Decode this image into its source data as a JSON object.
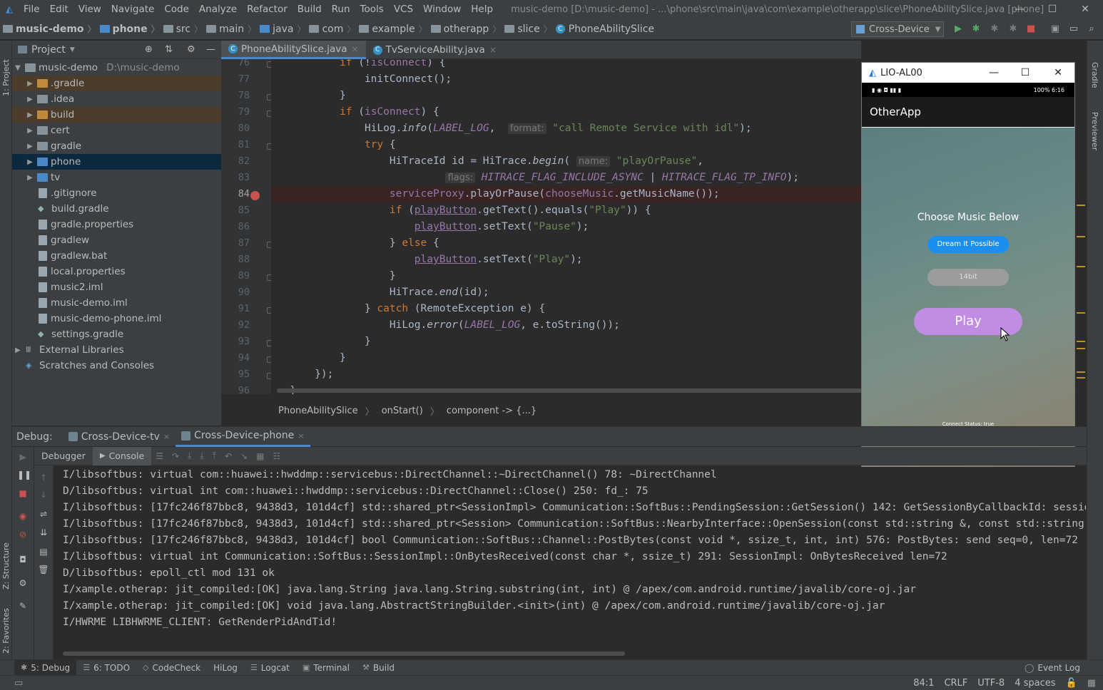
{
  "window": {
    "title": "music-demo [D:\\music-demo] - ...\\phone\\src\\main\\java\\com\\example\\otherapp\\slice\\PhoneAbilitySlice.java [phone]"
  },
  "menu": [
    "File",
    "Edit",
    "View",
    "Navigate",
    "Code",
    "Analyze",
    "Refactor",
    "Build",
    "Run",
    "Tools",
    "VCS",
    "Window",
    "Help"
  ],
  "breadcrumb": [
    "music-demo",
    "phone",
    "src",
    "main",
    "java",
    "com",
    "example",
    "otherapp",
    "slice",
    "PhoneAbilitySlice"
  ],
  "run_config": "Cross-Device",
  "left_strip": {
    "project_tab": "1: Project",
    "structure_tab": "Z: Structure",
    "favorites_tab": "2: Favorites"
  },
  "right_strip": {
    "gradle_tab": "Gradle",
    "previewer_tab": "Previewer"
  },
  "project": {
    "header": "Project",
    "tree": [
      {
        "label": "music-demo",
        "path": "D:\\music-demo"
      },
      {
        "label": ".gradle"
      },
      {
        "label": ".idea"
      },
      {
        "label": "build"
      },
      {
        "label": "cert"
      },
      {
        "label": "gradle"
      },
      {
        "label": "phone"
      },
      {
        "label": "tv"
      },
      {
        "label": ".gitignore"
      },
      {
        "label": "build.gradle"
      },
      {
        "label": "gradle.properties"
      },
      {
        "label": "gradlew"
      },
      {
        "label": "gradlew.bat"
      },
      {
        "label": "local.properties"
      },
      {
        "label": "music2.iml"
      },
      {
        "label": "music-demo.iml"
      },
      {
        "label": "music-demo-phone.iml"
      },
      {
        "label": "settings.gradle"
      },
      {
        "label": "External Libraries"
      },
      {
        "label": "Scratches and Consoles"
      }
    ]
  },
  "editor": {
    "tabs": [
      {
        "label": "PhoneAbilitySlice.java",
        "close": "×"
      },
      {
        "label": "TvServiceAbility.java",
        "close": "×"
      }
    ],
    "line_numbers": [
      "76",
      "77",
      "78",
      "79",
      "80",
      "81",
      "82",
      "83",
      "84",
      "85",
      "86",
      "87",
      "88",
      "89",
      "90",
      "91",
      "92",
      "93",
      "94",
      "95",
      "96"
    ],
    "code_crumbs": [
      "PhoneAbilitySlice",
      "onStart()",
      "component -> {...}"
    ]
  },
  "previewer": {
    "window_title": "LIO-AL00",
    "status_right": "100% 6:16",
    "app_title": "OtherApp",
    "heading": "Choose Music Below",
    "button_dream": "Dream It Possible",
    "button_14bit": "14bit",
    "button_play": "Play",
    "connect_status": "Connect Status: true"
  },
  "debug": {
    "label": "Debug:",
    "tabs": [
      {
        "label": "Cross-Device-tv",
        "close": "×"
      },
      {
        "label": "Cross-Device-phone",
        "close": "×"
      }
    ],
    "subtabs": [
      "Debugger",
      "Console"
    ],
    "console_lines": [
      "I/libsoftbus: virtual com::huawei::hwddmp::servicebus::DirectChannel::~DirectChannel() 78: ~DirectChannel",
      "D/libsoftbus: virtual int com::huawei::hwddmp::servicebus::DirectChannel::Close() 250: fd_: 75",
      "I/libsoftbus: [17fc246f87bbc8, 9438d3, 101d4cf] std::shared_ptr<SessionImpl> Communication::SoftBus::PendingSession::GetSession() 142: GetSessionByCallbackId: sessionName:com.exa",
      "I/libsoftbus: [17fc246f87bbc8, 9438d3, 101d4cf] std::shared_ptr<Session> Communication::SoftBus::NearbyInterface::OpenSession(const std::string &, const std::string &",
      "I/libsoftbus: [17fc246f87bbc8, 9438d3, 101d4cf] bool Communication::SoftBus::Channel::PostBytes(const void *, ssize_t, int, int) 576: PostBytes: send seq=0, len=72",
      "I/libsoftbus: virtual int Communication::SoftBus::SessionImpl::OnBytesReceived(const char *, ssize_t) 291: SessionImpl: OnBytesReceived len=72",
      "D/libsoftbus: epoll_ctl mod 131 ok",
      "I/xample.otherap: jit_compiled:[OK] java.lang.String java.lang.String.substring(int, int) @ /apex/com.android.runtime/javalib/core-oj.jar",
      "I/xample.otherap: jit_compiled:[OK] void java.lang.AbstractStringBuilder.<init>(int) @ /apex/com.android.runtime/javalib/core-oj.jar",
      "I/HWRME LIBHWRME_CLIENT: GetRenderPidAndTid!"
    ]
  },
  "bottom_tabs": [
    "5: Debug",
    "6: TODO",
    "CodeCheck",
    "HiLog",
    "Logcat",
    "Terminal",
    "Build"
  ],
  "event_log": "Event Log",
  "status": {
    "position": "84:1",
    "line_sep": "CRLF",
    "encoding": "UTF-8",
    "indent": "4 spaces"
  },
  "colors": {
    "accent": "#4a88c7",
    "breakpoint": "#c75450",
    "play_button": "#c08ce4",
    "dream_button": "#1a8ff0"
  }
}
